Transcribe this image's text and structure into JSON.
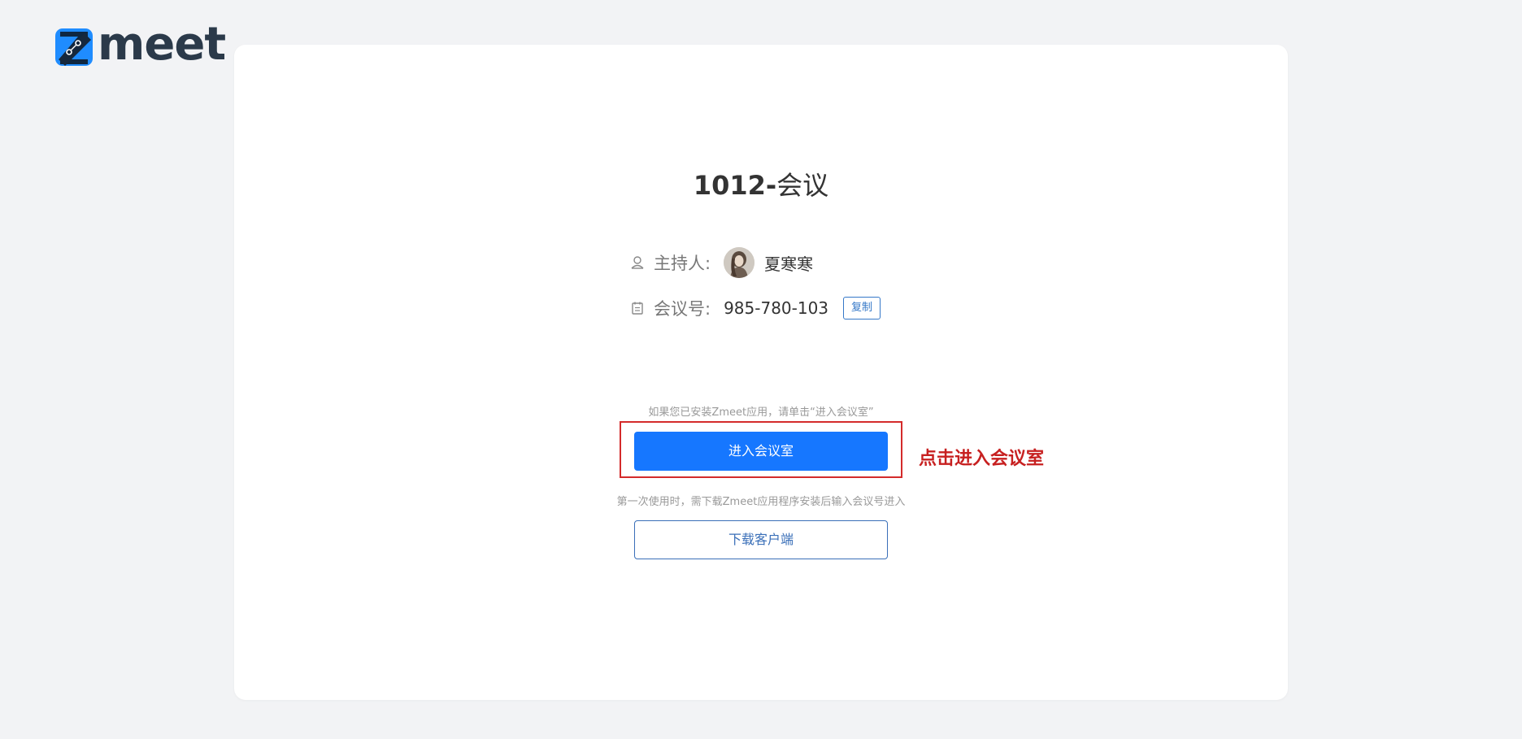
{
  "brand": {
    "logo_text": "meet",
    "accent_color": "#1677ff",
    "dark_color": "#2b3a4a"
  },
  "meeting": {
    "title_number": "1012-",
    "title_text": "会议",
    "host_label": "主持人:",
    "host_name": "夏寒寒",
    "id_label": "会议号:",
    "id_value": "985-780-103",
    "copy_label": "复制"
  },
  "actions": {
    "enter_hint": "如果您已安装Zmeet应用，请单击“进入会议室”",
    "enter_label": "进入会议室",
    "download_hint": "第一次使用时，需下载Zmeet应用程序安装后输入会议号进入",
    "download_label": "下载客户端"
  },
  "annotation": {
    "text": "点击进入会议室",
    "color": "#c72020"
  },
  "icons": {
    "host": "person-icon",
    "meeting_id": "calendar-icon"
  }
}
